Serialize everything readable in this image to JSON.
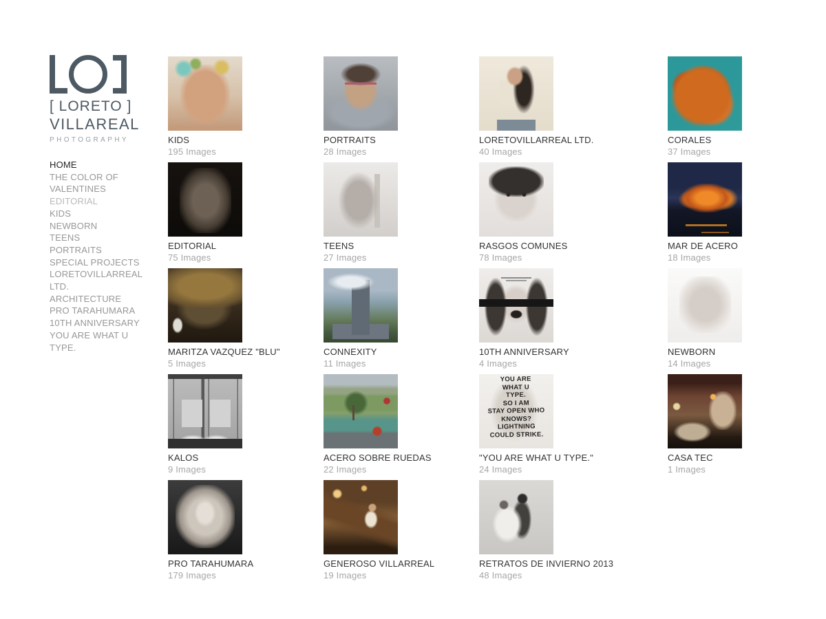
{
  "brand": {
    "mark": "LO]",
    "line1": "[ LORETO ]",
    "line2": "VILLAREAL",
    "line3": "PHOTOGRAPHY",
    "logo_color": "#4d5963",
    "photography_color": "#98a0a7"
  },
  "sidebar": {
    "items": [
      {
        "label": "HOME",
        "state": "active"
      },
      {
        "label": "THE COLOR OF VALENTINES",
        "state": "normal"
      },
      {
        "label": "EDITORIAL",
        "state": "muted"
      },
      {
        "label": "KIDS",
        "state": "normal"
      },
      {
        "label": "NEWBORN",
        "state": "normal"
      },
      {
        "label": "TEENS",
        "state": "normal"
      },
      {
        "label": "PORTRAITS",
        "state": "normal"
      },
      {
        "label": "SPECIAL PROJECTS",
        "state": "normal"
      },
      {
        "label": "LORETOVILLARREAL LTD.",
        "state": "normal"
      },
      {
        "label": "ARCHITECTURE",
        "state": "normal"
      },
      {
        "label": "PRO TARAHUMARA",
        "state": "normal"
      },
      {
        "label": "10TH ANNIVERSARY",
        "state": "normal"
      },
      {
        "label": "YOU ARE WHAT U TYPE.",
        "state": "normal"
      }
    ]
  },
  "colors": {
    "page_bg": "#ffffff",
    "title_text": "#323232",
    "count_text": "#a6a6a6",
    "nav_text": "#979797",
    "nav_active": "#232323",
    "nav_muted": "#b9b9b9"
  },
  "gallery": {
    "items": [
      {
        "title": "KIDS",
        "count": "195 Images",
        "thumb_style": "background: radial-gradient(circle, #7cc7bd 0 40%, rgba(124,199,189,0) 70%) 10% 6% / 30px 26px no-repeat, radial-gradient(circle, #d9bd62 0 40%, rgba(217,189,98,0) 70%) 80% 5% / 28px 24px no-repeat, radial-gradient(circle, #8fae5e 0 40%, rgba(143,174,94,0) 70%) 34% 2% / 22px 18px no-repeat, radial-gradient(ellipse, #d2a27f 0 55%, rgba(210,162,127,0) 75%) 50% 62% / 72px 88px no-repeat, linear-gradient(180deg, #e4dacb, #d6c0a8 55%, #c29878);"
      },
      {
        "title": "PORTRAITS",
        "count": "28 Images",
        "thumb_style": "background: linear-gradient(#b05a74,#b05a74) 50% 36% / 46px 3px no-repeat, radial-gradient(ellipse, #4f4138 0 45%, rgba(79,65,56,0) 70%) 50% 12% / 60px 34px no-repeat, radial-gradient(ellipse, #c3a183 0 50%, rgba(195,161,131,0) 72%) 50% 40% / 52px 62px no-repeat, radial-gradient(ellipse, #9fa6ad 0 55%, rgba(159,166,173,0) 75%) 50% 98% / 100px 52px no-repeat, linear-gradient(180deg, #b9bdc1, #8f959b);"
      },
      {
        "title": "LORETOVILLARREAL LTD.",
        "count": "40 Images",
        "thumb_style": "background: radial-gradient(ellipse, #caa184 0 50%, rgba(202,161,132,0) 70%) 47% 18% / 26px 30px no-repeat, radial-gradient(ellipse, #2e2620 0 45%, rgba(46,38,32,0) 70%) 64% 34% / 32px 72px no-repeat, linear-gradient(#e9e2d2,#e9e2d2) 44% 48% / 40px 36px no-repeat, linear-gradient(#7d8b97,#7d8b97) 50% 100% / 56px 16px no-repeat, linear-gradient(180deg, #efe9dc, #e4dccb);"
      },
      {
        "title": "CORALES",
        "count": "37 Images",
        "thumb_style": "background: radial-gradient(circle, #cf6a1f 0 55%, rgba(207,106,31,0) 68%) 16% 80% / 95px 95px no-repeat, radial-gradient(circle, #c35e1c 0 55%, rgba(195,94,28,0) 68%) 46% 42% / 82px 82px no-repeat, radial-gradient(circle, #d4742a 0 50%, rgba(212,116,42,0) 65%) 82% 92% / 70px 70px no-repeat, radial-gradient(circle, #b5541a 0 45%, rgba(181,84,26,0) 60%) 6% 28% / 50px 55px no-repeat, linear-gradient(135deg, #2d9899 55%, #2f9b9b);"
      },
      {
        "title": "EDITORIAL",
        "count": "75 Images",
        "thumb_style": "background: radial-gradient(ellipse, #6d6054 0 35%, #453c32 60%, rgba(30,26,22,0) 78%) 50% 58% / 75px 95px no-repeat, linear-gradient(180deg, #17120f, #0d0b09);"
      },
      {
        "title": "TEENS",
        "count": "27 Images",
        "thumb_style": "background: radial-gradient(ellipse, #b5aea8 0 45%, rgba(181,174,168,0) 70%) 44% 55% / 60px 85px no-repeat, linear-gradient(#c9c3bd,#c9c3bd) 74% 58% / 8px 78px no-repeat, linear-gradient(180deg, #eceae8, #d2cecb);"
      },
      {
        "title": "RASGOS COMUNES",
        "count": "78 Images",
        "thumb_style": "background: radial-gradient(circle, #2a2623 0 45%, rgba(42,38,35,0) 60%) 38% 43% / 9px 6px no-repeat, radial-gradient(circle, #2a2623 0 45%, rgba(42,38,35,0) 60%) 62% 43% / 9px 6px no-repeat, radial-gradient(ellipse, #33302d 0 60%, rgba(51,48,45,0) 75%) 50% 10% / 80px 44px no-repeat, radial-gradient(ellipse, #dad3cd 0 55%, rgba(218,211,205,0) 75%) 50% 50% / 62px 64px no-repeat, linear-gradient(180deg, #efedeb, #e2dedb);"
      },
      {
        "title": "MAR DE ACERO",
        "count": "18 Images",
        "thumb_style": "background: radial-gradient(ellipse, #f08a28 0 30%, #c2571a 55%, rgba(194,87,26,0) 75%) 58% 47% / 72px 42px no-repeat, radial-gradient(ellipse, #f08a28 0 35%, rgba(240,138,40,0) 70%) 92% 48% / 46px 34px no-repeat, radial-gradient(ellipse, #d96a1e 0 35%, rgba(217,106,30,0) 70%) 22% 50% / 42px 28px no-repeat, linear-gradient(#b07022,#b07022) 55% 86% / 60px 3px no-repeat, linear-gradient(#8a5516,#8a5516) 72% 95% / 40px 2px no-repeat, linear-gradient(180deg, #1f2947 0 35%, #2a3558 48%, #131726 64%, #0c0f1a);"
      },
      {
        "title": "MARITZA VAZQUEZ \"BLU\"",
        "count": "5 Images",
        "thumb_style": "background: radial-gradient(ellipse, #96783f 0 40%, #6b5530 65%, rgba(107,85,48,0) 80%) 50% -10% / 135px 62px no-repeat, radial-gradient(ellipse, #5e4e34 0 45%, rgba(94,78,52,0) 70%) 47% 62% / 82px 60px no-repeat, radial-gradient(ellipse, #e0ddd6 0 50%, rgba(224,221,214,0) 70%) 7% 84% / 16px 24px no-repeat, linear-gradient(180deg, #4a3a26 0 30%, #32271a 60%, #20180f);"
      },
      {
        "title": "CONNEXITY",
        "count": "11 Images",
        "thumb_style": "background: radial-gradient(ellipse, #e6ecf0 0 40%, rgba(230,236,240,0) 70%) 14% 8% / 70px 26px no-repeat, linear-gradient(#5f6a74,#5f6a74) 50% 62% / 26px 80px no-repeat, linear-gradient(#6d7680,#6d7680) 50% 94% / 82px 22px no-repeat, linear-gradient(180deg, #a9b8c4 0 30%, #8aa2ae 45%, #647a5a 70%, #42583f 88%, #37482f);"
      },
      {
        "title": "10TH ANNIVERSARY",
        "count": "4 Images",
        "thumb_style": "background: linear-gradient(#161616,#161616) 0 46% / 100% 11px no-repeat, linear-gradient(#8a8a8a,#8a8a8a) 50% 12% / 44px 2px no-repeat, linear-gradient(#9a9a9a,#9a9a9a) 50% 16% / 30px 2px no-repeat, radial-gradient(ellipse, #241f1c 0 50%, rgba(36,31,28,0) 65%) 50% 64% / 20px 14px no-repeat, radial-gradient(ellipse, #3c3733 0 55%, rgba(60,55,51,0) 72%) 10% 58% / 32px 84px no-repeat, radial-gradient(ellipse, #3c3733 0 55%, rgba(60,55,51,0) 72%) 90% 58% / 32px 84px no-repeat, radial-gradient(ellipse, #d8cfc8 0 50%, rgba(216,207,200,0) 70%) 50% 46% / 48px 58px no-repeat, linear-gradient(180deg, #efedeb, #dcd8d4);"
      },
      {
        "title": "NEWBORN",
        "count": "14 Images",
        "thumb_style": "background: radial-gradient(ellipse, #d5cdc7 0 40%, #e8e4e0 65%, rgba(232,228,224,0) 80%) 52% 45% / 75px 82px no-repeat, linear-gradient(180deg, #fafaf9, #efedeb);"
      },
      {
        "title": "KALOS",
        "count": "9 Images",
        "thumb_style": "background: linear-gradient(#3f3f3f,#3f3f3f) 0 0 / 100% 7px no-repeat, linear-gradient(#303030,#303030) 50% 100% / 100% 14px no-repeat, radial-gradient(ellipse, #e8e8e8 0 40%, rgba(232,232,232,0) 70%) 22% 98% / 42px 18px no-repeat, radial-gradient(ellipse, #e8e8e8 0 40%, rgba(232,232,232,0) 70%) 74% 98% / 42px 18px no-repeat, linear-gradient(#d2d2d2,#d2d2d2) 26% 55% / 30px 40px no-repeat, linear-gradient(#d2d2d2,#d2d2d2) 78% 55% / 30px 40px no-repeat, linear-gradient(90deg, rgba(0,0,0,0) 0 7%, #6a6a6a 7% 8.5%, rgba(0,0,0,0) 8.5% 45%, #585858 45% 49%, rgba(0,0,0,0) 49% 54%, #6a6a6a 54% 55.5%, rgba(0,0,0,0) 55.5% 93%, #6a6a6a 93% 94.5%, rgba(0,0,0,0) 94.5%) 0 0 / 100% 100% no-repeat, linear-gradient(180deg, #bcbcbc, #a2a2a2);"
      },
      {
        "title": "ACERO SOBRE RUEDAS",
        "count": "22 Images",
        "thumb_style": "background: radial-gradient(circle, #b5402a 0 50%, rgba(181,64,42,0) 65%) 76% 82% / 16px 16px no-repeat, linear-gradient(#5c4a38,#5c4a38) 40% 52% / 3px 22px no-repeat, radial-gradient(circle, #49683a 0 45%, rgba(73,104,58,0) 65%) 40% 34% / 42px 36px no-repeat, radial-gradient(circle, #b03636 0 45%, rgba(176,54,54,0) 60%) 90% 34% / 14px 12px no-repeat, linear-gradient(180deg, #b3bcc0 0 14%, #93a383 20% 26%, #7d9a62 30% 48%, #86a06a 52%, #57948a 62% 76%, #6a7275 80%);"
      },
      {
        "title": "\"YOU ARE WHAT U TYPE.\"",
        "count": "24 Images",
        "overlay_text": "YOU ARE\nWHAT U\nTYPE.\nSO I AM\nSTAY OPEN WHO KNOWS?\nLIGHTNING\nCOULD STRIKE.",
        "thumb_style": "background: radial-gradient(ellipse, #d8d2ca 0 50%, rgba(216,210,202,0) 72%) 42% 40% / 70px 92px no-repeat, linear-gradient(180deg, #f2f0ed, #e8e5e0);"
      },
      {
        "title": "CASA TEC",
        "count": "1 Images",
        "thumb_style": "background: radial-gradient(circle, #f0b65a 0 40%, rgba(240,182,90,0) 65%) 62% 28% / 10px 12px no-repeat, radial-gradient(circle, #e8d7a0 0 40%, rgba(232,215,160,0) 60%) 7% 42% / 12px 16px no-repeat, radial-gradient(ellipse, #c9b195 0 55%, rgba(201,177,149,0) 75%) 88% 48% / 40px 56px no-repeat, radial-gradient(ellipse, #bfae94 0 50%, rgba(191,174,148,0) 70%) 16% 88% / 56px 30px no-repeat, linear-gradient(180deg, #3a2018 0 12%, #6e4433 30%, #7a5a40 55%, #241a12 85%, #15100b);"
      },
      {
        "title": "PRO TARAHUMARA",
        "count": "179 Images",
        "thumb_style": "background: radial-gradient(ellipse, #e4ded6 0 45%, rgba(228,222,214,0) 65%) 50% 40% / 34px 44px no-repeat, radial-gradient(ellipse, #cdc6bc 0 40%, #9e968c 60%, rgba(158,150,140,0) 75%) 50% 44% / 86px 92px no-repeat, linear-gradient(180deg, #3c3c3c, #181818);"
      },
      {
        "title": "GENEROSO VILLARREAL",
        "count": "19 Images",
        "thumb_style": "background: radial-gradient(circle, #f0cd82 0 35%, rgba(240,205,130,0) 60%) 12% 12% / 18px 18px no-repeat, radial-gradient(circle, #e3b96a 0 35%, rgba(227,185,106,0) 60%) 55% 6% / 12px 12px no-repeat, radial-gradient(ellipse, #ece4d2 0 45%, rgba(236,228,210,0) 65%) 68% 54% / 22px 30px no-repeat, radial-gradient(circle, #caa27a 0 45%, rgba(202,162,122,0) 65%) 68% 35% / 14px 14px no-repeat, linear-gradient(200deg, rgba(0,0,0,0) 35%, #6a4526 45% 60%, rgba(0,0,0,0) 70%) 0 0 / 100% 100% no-repeat, linear-gradient(180deg, #5e4026 0 30%, #8a6238 55%, #2c1d10 90%);"
      },
      {
        "title": "RETRATOS DE INVIERNO 2013",
        "count": "48 Images",
        "thumb_style": "background: radial-gradient(circle, #6a6560 0 45%, rgba(106,101,96,0) 65%) 30% 30% / 16px 16px no-repeat, radial-gradient(ellipse, #f0eeea 0 50%, rgba(240,238,234,0) 70%) 30% 70% / 44px 56px no-repeat, radial-gradient(circle, #2e2c2a 0 45%, rgba(46,44,42,0) 65%) 60% 20% / 18px 18px no-repeat, radial-gradient(ellipse, #43413e 0 50%, rgba(67,65,62,0) 68%) 60% 56% / 30px 62px no-repeat, linear-gradient(180deg, #dbd9d6, #c9c7c4);"
      }
    ]
  }
}
